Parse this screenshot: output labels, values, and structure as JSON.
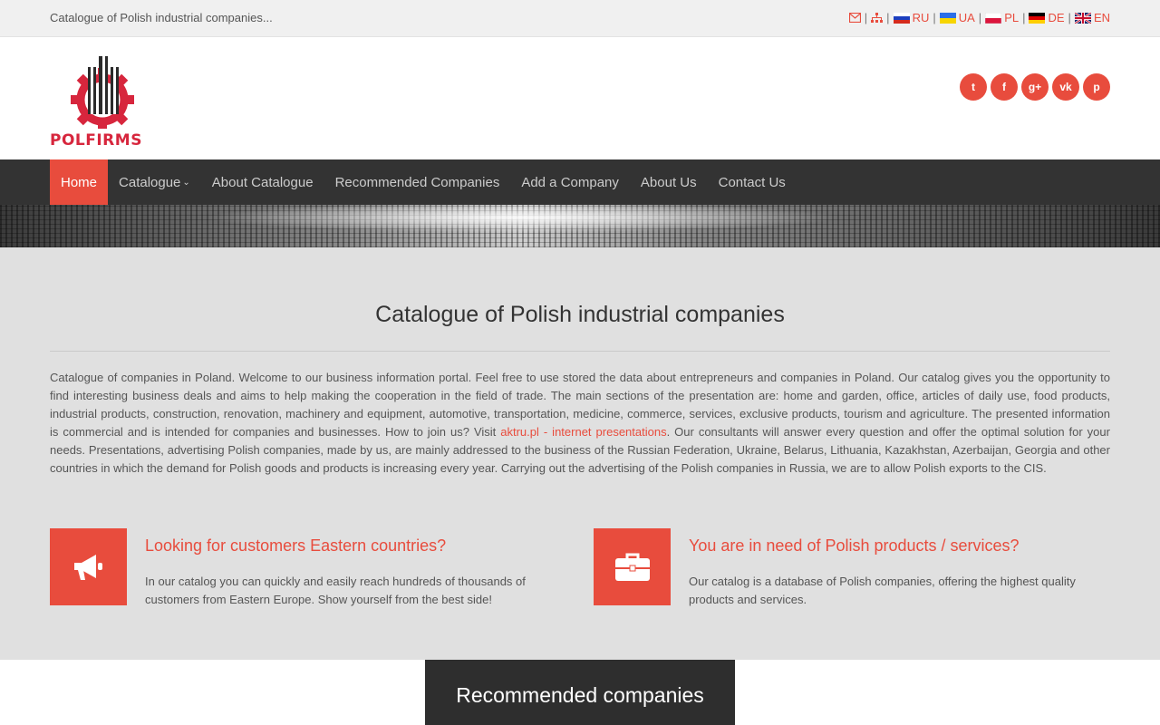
{
  "topbar": {
    "tagline": "Catalogue of Polish industrial companies...",
    "icons": [
      "envelope-icon",
      "sitemap-icon"
    ],
    "languages": [
      {
        "code": "RU",
        "flag": "russia"
      },
      {
        "code": "UA",
        "flag": "ukraine"
      },
      {
        "code": "PL",
        "flag": "poland"
      },
      {
        "code": "DE",
        "flag": "germany"
      },
      {
        "code": "EN",
        "flag": "uk"
      }
    ],
    "separator": "|"
  },
  "header": {
    "logo_text": "POLFIRMS",
    "social": [
      {
        "name": "twitter",
        "glyph": "t"
      },
      {
        "name": "facebook",
        "glyph": "f"
      },
      {
        "name": "google-plus",
        "glyph": "g+"
      },
      {
        "name": "vk",
        "glyph": "vk"
      },
      {
        "name": "pinterest",
        "glyph": "p"
      }
    ]
  },
  "nav": {
    "items": [
      {
        "label": "Home",
        "active": true
      },
      {
        "label": "Catalogue",
        "dropdown": true
      },
      {
        "label": "About Catalogue"
      },
      {
        "label": "Recommended Companies"
      },
      {
        "label": "Add a Company"
      },
      {
        "label": "About Us"
      },
      {
        "label": "Contact Us"
      }
    ]
  },
  "main": {
    "title": "Catalogue of Polish industrial companies",
    "intro_before": "Catalogue of companies in Poland. Welcome to our business information portal. Feel free to use stored the data about entrepreneurs and companies in Poland. Our catalog gives you the opportunity to find interesting business deals and aims to help making the cooperation in the field of trade. The main sections of the presentation are: home and garden, office, articles of daily use, food products, industrial products, construction, renovation, machinery and equipment, automotive, transportation, medicine, commerce, services, exclusive products, tourism and agriculture. The presented information is commercial and is intended for companies and businesses. How to join us? Visit ",
    "intro_link": "aktru.pl - internet presentations",
    "intro_after": ". Our consultants will answer every question and offer the optimal solution for your needs. Presentations, advertising Polish companies, made by us, are mainly addressed to the business of the Russian Federation, Ukraine, Belarus, Lithuania, Kazakhstan, Azerbaijan, Georgia and other countries in which the demand for Polish goods and products is increasing every year. Carrying out the advertising of the Polish companies in Russia, we are to allow Polish exports to the CIS.",
    "features": [
      {
        "icon": "megaphone-icon",
        "title": "Looking for customers Eastern countries?",
        "text": "In our catalog you can quickly and easily reach hundreds of thousands of customers from Eastern Europe. Show yourself from the best side!"
      },
      {
        "icon": "briefcase-icon",
        "title": "You are in need of Polish products / services?",
        "text": "Our catalog is a database of Polish companies, offering the highest quality products and services."
      }
    ]
  },
  "recommended": {
    "title": "Recommended companies"
  },
  "colors": {
    "accent": "#e84c3d",
    "nav_bg": "#333333",
    "main_bg": "#e0e0e0",
    "topbar_bg": "#f0f0f0"
  }
}
